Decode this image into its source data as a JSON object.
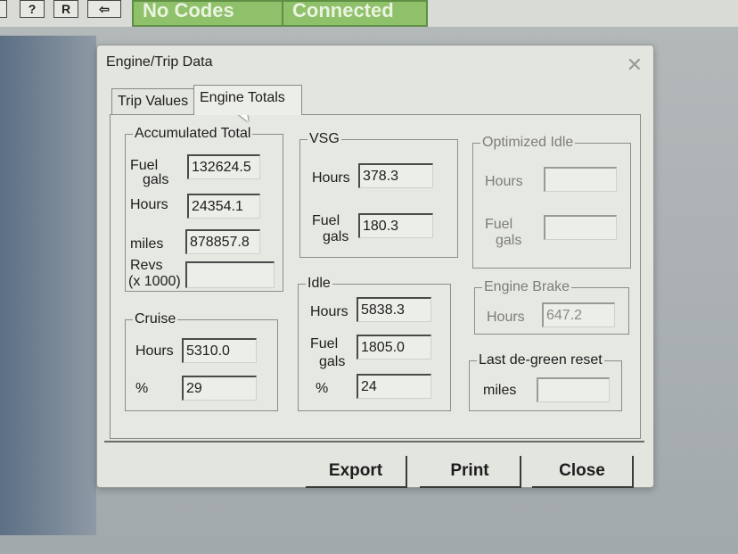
{
  "toolbar": {
    "btn1": "?",
    "btn2": "R",
    "btn3": "⇦",
    "status_codes": "No Codes",
    "status_conn": "Connected"
  },
  "dialog": {
    "title": "Engine/Trip Data",
    "close_icon": "✕",
    "tabs": [
      {
        "label": "Trip Values"
      },
      {
        "label": "Engine Totals"
      }
    ],
    "accumulated": {
      "legend": "Accumulated Total",
      "fuel_label": "Fuel",
      "gals_label": "gals",
      "fuel_value": "132624.5",
      "hours_label": "Hours",
      "hours_value": "24354.1",
      "miles_label": "miles",
      "miles_value": "878857.8",
      "revs_label": "Revs",
      "revs_unit": "(x 1000)",
      "revs_value": ""
    },
    "cruise": {
      "legend": "Cruise",
      "hours_label": "Hours",
      "hours_value": "5310.0",
      "pct_label": "%",
      "pct_value": "29"
    },
    "vsg": {
      "legend": "VSG",
      "hours_label": "Hours",
      "hours_value": "378.3",
      "fuel_label": "Fuel",
      "gals_label": "gals",
      "fuel_value": "180.3"
    },
    "idle": {
      "legend": "Idle",
      "hours_label": "Hours",
      "hours_value": "5838.3",
      "fuel_label": "Fuel",
      "gals_label": "gals",
      "fuel_value": "1805.0",
      "pct_label": "%",
      "pct_value": "24"
    },
    "optimized_idle": {
      "legend": "Optimized Idle",
      "hours_label": "Hours",
      "hours_value": "",
      "fuel_label": "Fuel",
      "gals_label": "gals",
      "fuel_value": ""
    },
    "engine_brake": {
      "legend": "Engine Brake",
      "hours_label": "Hours",
      "hours_value": "647.2"
    },
    "degreen": {
      "legend": "Last de-green reset",
      "miles_label": "miles",
      "miles_value": ""
    },
    "buttons": {
      "export": "Export",
      "print": "Print",
      "close": "Close"
    }
  }
}
